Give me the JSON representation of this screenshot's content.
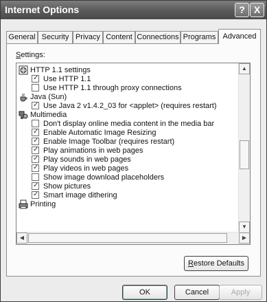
{
  "window": {
    "title": "Internet Options",
    "help_button": "?",
    "close_button": "X"
  },
  "tabs": [
    {
      "label": "General"
    },
    {
      "label": "Security"
    },
    {
      "label": "Privacy"
    },
    {
      "label": "Content"
    },
    {
      "label": "Connections"
    },
    {
      "label": "Programs"
    },
    {
      "label": "Advanced",
      "active": true
    }
  ],
  "settings": {
    "label_underlined": "S",
    "label_rest": "ettings:",
    "items": [
      {
        "label": "HTTP 1.1 settings",
        "kind": "category",
        "icon": "globe-icon"
      },
      {
        "label": "Use HTTP 1.1",
        "kind": "checkbox",
        "checked": true
      },
      {
        "label": "Use HTTP 1.1 through proxy connections",
        "kind": "checkbox",
        "checked": false
      },
      {
        "label": "Java (Sun)",
        "kind": "category",
        "icon": "java-cup-icon"
      },
      {
        "label": "Use Java 2 v1.4.2_03 for <applet> (requires restart)",
        "kind": "checkbox",
        "checked": true
      },
      {
        "label": "Multimedia",
        "kind": "category",
        "icon": "multimedia-icon"
      },
      {
        "label": "Don't display online media content in the media bar",
        "kind": "checkbox",
        "checked": false
      },
      {
        "label": "Enable Automatic Image Resizing",
        "kind": "checkbox",
        "checked": true
      },
      {
        "label": "Enable Image Toolbar (requires restart)",
        "kind": "checkbox",
        "checked": true
      },
      {
        "label": "Play animations in web pages",
        "kind": "checkbox",
        "checked": true
      },
      {
        "label": "Play sounds in web pages",
        "kind": "checkbox",
        "checked": true
      },
      {
        "label": "Play videos in web pages",
        "kind": "checkbox",
        "checked": true
      },
      {
        "label": "Show image download placeholders",
        "kind": "checkbox",
        "checked": false
      },
      {
        "label": "Show pictures",
        "kind": "checkbox",
        "checked": true
      },
      {
        "label": "Smart image dithering",
        "kind": "checkbox",
        "checked": true
      },
      {
        "label": "Printing",
        "kind": "category",
        "icon": "printer-icon"
      }
    ]
  },
  "buttons": {
    "restore_underlined": "R",
    "restore_rest": "estore Defaults",
    "ok": "OK",
    "cancel": "Cancel",
    "apply": "Apply"
  }
}
